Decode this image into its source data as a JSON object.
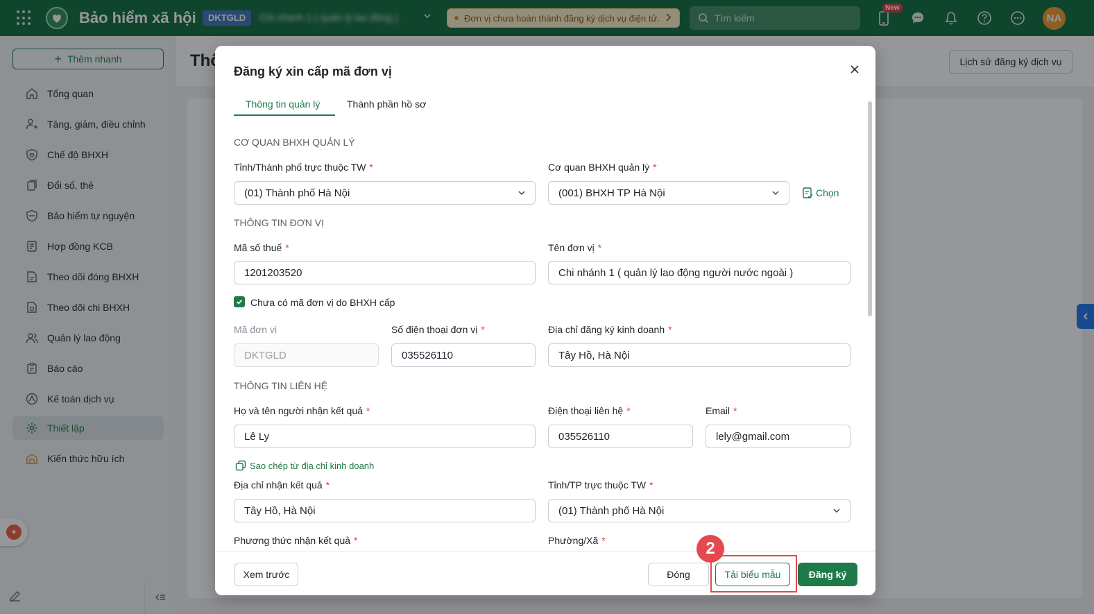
{
  "topbar": {
    "brand": "Bảo hiểm xã hội",
    "unit_code": "DKTGLD",
    "unit_name": "Chi nhánh 1 ( quản lý lao động )",
    "warning": "Đơn vị chưa hoàn thành đăng ký dịch vụ điện tử.",
    "search_placeholder": "Tìm kiếm",
    "new_badge": "New",
    "avatar": "NA",
    "colors": {
      "bar": "#0e6b3b",
      "accent": "#1f7a4a",
      "warning_bg": "#fdf1c6",
      "avatar": "#f09a2b",
      "annotation": "#e5484d"
    }
  },
  "sidebar": {
    "quick_add": "Thêm nhanh",
    "items": [
      {
        "label": "Tổng quan",
        "icon": "home-icon"
      },
      {
        "label": "Tăng, giảm, điều chỉnh",
        "icon": "user-adjust-icon"
      },
      {
        "label": "Chế độ BHXH",
        "icon": "shield-care-icon"
      },
      {
        "label": "Đổi sổ, thẻ",
        "icon": "card-swap-icon"
      },
      {
        "label": "Bảo hiểm tự nguyện",
        "icon": "shield-icon"
      },
      {
        "label": "Hợp đồng KCB",
        "icon": "contract-icon"
      },
      {
        "label": "Theo dõi đóng BHXH",
        "icon": "document-c12-icon"
      },
      {
        "label": "Theo dõi chi BHXH",
        "icon": "document-money-icon"
      },
      {
        "label": "Quản lý lao động",
        "icon": "people-icon"
      },
      {
        "label": "Báo cáo",
        "icon": "report-icon"
      },
      {
        "label": "Kế toán dịch vụ",
        "icon": "accounting-icon"
      },
      {
        "label": "Thiết lập",
        "icon": "gear-icon"
      },
      {
        "label": "Kiến thức hữu ích",
        "icon": "knowledge-icon"
      }
    ]
  },
  "page": {
    "title": "Thô",
    "history_button": "Lịch sử đăng ký dịch vụ"
  },
  "modal": {
    "title": "Đăng ký xin cấp mã đơn vị",
    "tabs": [
      "Thông tin quản lý",
      "Thành phần hồ sơ"
    ],
    "sections": {
      "agency": "CƠ QUAN BHXH QUẢN LÝ",
      "unit": "THÔNG TIN ĐƠN VỊ",
      "contact": "THÔNG TIN LIÊN HỆ"
    },
    "fields": {
      "province": {
        "label": "Tỉnh/Thành phố trực thuộc TW",
        "value": "(01) Thành phố Hà Nội"
      },
      "agency": {
        "label": "Cơ quan BHXH quản lý",
        "value": "(001) BHXH TP Hà Nội"
      },
      "tax_code": {
        "label": "Mã số thuế",
        "value": "1201203520"
      },
      "unit_name": {
        "label": "Tên đơn vị",
        "value": "Chi nhánh 1 ( quản lý lao động người nước ngoài )"
      },
      "unit_code": {
        "label": "Mã đơn vị",
        "value": "DKTGLD"
      },
      "unit_phone": {
        "label": "Số điện thoại đơn vị",
        "value": "035526110"
      },
      "business_address": {
        "label": "Địa chỉ đăng ký kinh doanh",
        "value": "Tây Hồ, Hà Nội"
      },
      "recipient_name": {
        "label": "Họ và tên người nhận kết quả",
        "value": "Lê Ly"
      },
      "contact_phone": {
        "label": "Điện thoại liên hệ",
        "value": "035526110"
      },
      "email": {
        "label": "Email",
        "value": "lely@gmail.com"
      },
      "result_address": {
        "label": "Địa chỉ nhận kết quả",
        "value": "Tây Hồ, Hà Nội"
      },
      "result_province": {
        "label": "Tỉnh/TP trực thuộc TW",
        "value": "(01) Thành phố Hà Nội"
      },
      "receive_method": {
        "label": "Phương thức nhận kết quả"
      },
      "ward": {
        "label": "Phường/Xã"
      }
    },
    "choose_link": "Chọn",
    "checkbox_label": "Chưa có mã đơn vị do BHXH cấp",
    "copy_link": "Sao chép từ địa chỉ kinh doanh",
    "required_mark": "*",
    "footer": {
      "preview": "Xem trước",
      "close": "Đóng",
      "download_template": "Tải biểu mẫu",
      "register": "Đăng ký"
    }
  },
  "annotation": {
    "step": "2"
  }
}
